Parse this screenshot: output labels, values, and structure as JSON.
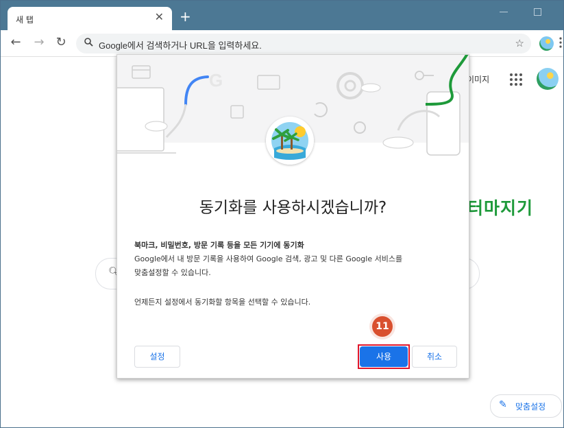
{
  "browser": {
    "tab_title": "새 탭",
    "tab_close": "✕",
    "new_tab": "+",
    "omnibox_placeholder": "Google에서 검색하거나 URL을 입력하세요."
  },
  "page": {
    "images_link": "이미지",
    "customize_label": "맞춤설정",
    "watermark": "컴퓨터마지기"
  },
  "dialog": {
    "title": "동기화를 사용하시겠습니까?",
    "body_heading": "북마크, 비밀번호, 방문 기록 등을 모든 기기에 동기화",
    "body_line1": "Google에서 내 방문 기록을 사용하여 Google 검색, 광고 및 다른 Google 서비스를",
    "body_line2": "맞춤설정할 수 있습니다.",
    "note": "언제든지 설정에서 동기화할 항목을 선택할 수 있습니다.",
    "settings_button": "설정",
    "use_button": "사용",
    "cancel_button": "취소"
  },
  "annotation": {
    "step_number": "11"
  },
  "colors": {
    "titlebar": "#4c7894",
    "accent_blue": "#1a73e8",
    "highlight_red": "#e0162b",
    "badge_orange": "#d9502f",
    "watermark_green": "#1e9a3a"
  }
}
